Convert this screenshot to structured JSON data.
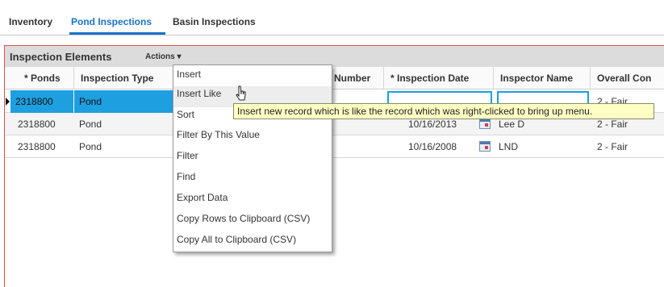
{
  "tabs": [
    "Inventory",
    "Pond Inspections",
    "Basin Inspections"
  ],
  "active_tab": "Pond Inspections",
  "panel": {
    "title": "Inspection Elements",
    "actions_label": "Actions ▾"
  },
  "columns": [
    "* Ponds",
    "Inspection Type",
    "Number",
    "* Inspection Date",
    "Inspector Name",
    "Overall Con"
  ],
  "rows": [
    {
      "pond": "2318800",
      "type": "Pond",
      "date": "",
      "inspector": "",
      "overall": "2 - Fair"
    },
    {
      "pond": "2318800",
      "type": "Pond",
      "date": "10/16/2013",
      "inspector": "Lee D",
      "overall": "2 - Fair"
    },
    {
      "pond": "2318800",
      "type": "Pond",
      "date": "10/16/2008",
      "inspector": "LND",
      "overall": "2 - Fair"
    }
  ],
  "context_menu": [
    "Insert",
    "Insert Like",
    "Sort",
    "Filter By This Value",
    "Filter",
    "Find",
    "Export Data",
    "Copy Rows to Clipboard (CSV)",
    "Copy All to Clipboard (CSV)"
  ],
  "hovered_menu_item": "Insert Like",
  "tooltip": "Insert new record which is like the record which was right-clicked to bring up menu.",
  "colors": {
    "accent": "#1a73c8",
    "selection": "#1e9fe0",
    "panel_border": "#e05050",
    "tooltip_bg": "#ffffc4"
  }
}
